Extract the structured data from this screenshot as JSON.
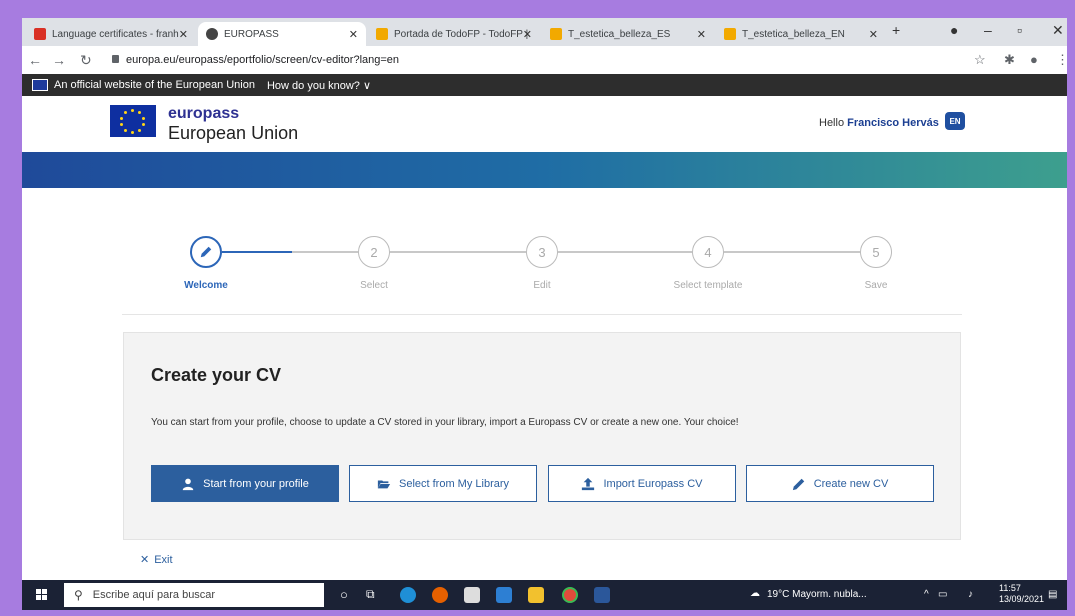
{
  "browser": {
    "tabs": [
      {
        "label": "Language certificates - franh",
        "favicon_color": "#d93025"
      },
      {
        "label": "EUROPASS",
        "favicon_color": "#444444"
      },
      {
        "label": "Portada de TodoFP - TodoFP |",
        "favicon_color": "#f2a900"
      },
      {
        "label": "T_estetica_belleza_ES",
        "favicon_color": "#f2a900"
      },
      {
        "label": "T_estetica_belleza_EN",
        "favicon_color": "#f2a900"
      }
    ],
    "new_tab": "+",
    "url": "europa.eu/europass/eportfolio/screen/cv-editor?lang=en"
  },
  "eu_banner": {
    "text": "An official website of the European Union",
    "how": "How do you know? ∨"
  },
  "header": {
    "brand": "europass",
    "subtitle": "European Union",
    "hello": "Hello",
    "user": "Francisco Hervás",
    "lang": "EN"
  },
  "stepper": {
    "steps": [
      {
        "num": "",
        "label": "Welcome",
        "active": true
      },
      {
        "num": "2",
        "label": "Select",
        "active": false
      },
      {
        "num": "3",
        "label": "Edit",
        "active": false
      },
      {
        "num": "4",
        "label": "Select template",
        "active": false
      },
      {
        "num": "5",
        "label": "Save",
        "active": false
      }
    ]
  },
  "card": {
    "title": "Create your CV",
    "description": "You can start from your profile, choose to update a CV stored in your library, import a Europass CV or create a new one. Your choice!",
    "buttons": {
      "profile": "Start from your profile",
      "library": "Select from My Library",
      "import": "Import Europass CV",
      "create": "Create new CV"
    }
  },
  "exit": "Exit",
  "taskbar": {
    "search_placeholder": "Escribe aquí para buscar",
    "weather": "19°C  Mayorm. nubla...",
    "time": "11:57",
    "date": "13/09/2021"
  },
  "colors": {
    "primary": "#2c5f9e",
    "eu_blue": "#0e2fa0",
    "accent_star": "#ffd617"
  }
}
